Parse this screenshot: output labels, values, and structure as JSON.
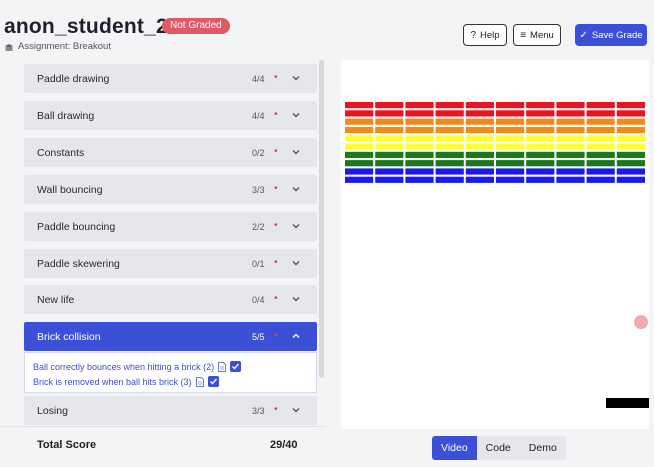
{
  "header": {
    "student_name": "anon_student_20",
    "status_badge": "Not Graded",
    "assignment_label": "Assignment: Breakout",
    "help_label": "Help",
    "menu_label": "Menu",
    "save_label": "Save Grade",
    "accent_color": "#3b50d6",
    "badge_color": "#e05a64"
  },
  "rubric": {
    "items": [
      {
        "label": "Paddle drawing",
        "score": "4/4"
      },
      {
        "label": "Ball drawing",
        "score": "4/4"
      },
      {
        "label": "Constants",
        "score": "0/2"
      },
      {
        "label": "Wall bouncing",
        "score": "3/3"
      },
      {
        "label": "Paddle bouncing",
        "score": "2/2"
      },
      {
        "label": "Paddle skewering",
        "score": "0/1"
      },
      {
        "label": "New life",
        "score": "0/4"
      },
      {
        "label": "Brick collision",
        "score": "5/5",
        "expanded": true
      },
      {
        "label": "Losing",
        "score": "3/3"
      }
    ],
    "expanded_checks": [
      {
        "label": "Ball correctly bounces when hitting a brick (2)",
        "checked": true
      },
      {
        "label": "Brick is removed when ball hits brick (3)",
        "checked": true
      }
    ]
  },
  "total": {
    "label": "Total Score",
    "value": "29/40"
  },
  "game": {
    "brick_colors": [
      "#e8141e",
      "#e8141e",
      "#f28b1e",
      "#f28b1e",
      "#ffff33",
      "#ffff33",
      "#1a7a1a",
      "#1a7a1a",
      "#1a1aee",
      "#1a1aee"
    ],
    "brick_columns": 10,
    "ball_color": "#f2a8b0",
    "paddle_color": "#000000"
  },
  "view_tabs": [
    {
      "label": "Video",
      "active": true
    },
    {
      "label": "Code",
      "active": false
    },
    {
      "label": "Demo",
      "active": false
    }
  ]
}
